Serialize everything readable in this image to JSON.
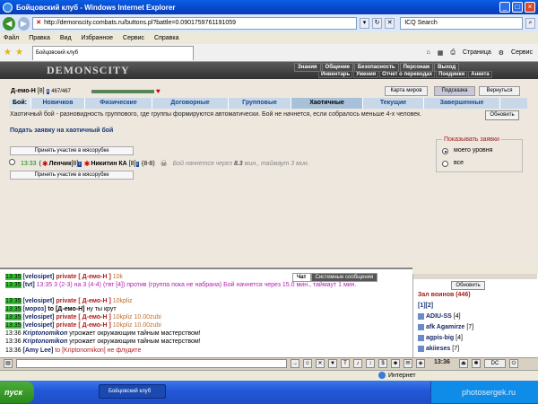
{
  "window": {
    "title": "Бойцовский клуб - Windows Internet Explorer"
  },
  "address": {
    "url": "http://demonscity.combats.ru/buttons.pl?battle=0.0901759761191059",
    "search_placeholder": "ICQ Search"
  },
  "menu": [
    "Файл",
    "Правка",
    "Вид",
    "Избранное",
    "Сервис",
    "Справка"
  ],
  "browser_tab": {
    "label": "Бойцовский клуб"
  },
  "browser_tools": {
    "page": "Страница",
    "tools": "Сервис"
  },
  "game": {
    "logo": "DEMONSCITY",
    "nav_top": [
      "Знания",
      "Общение",
      "Безопасность",
      "Персонаж",
      "Выход"
    ],
    "nav_bottom": [
      "Инвентарь",
      "Умения",
      "Отчет о переводах",
      "Поединки",
      "Анкета"
    ]
  },
  "player": {
    "name": "Д-емо-Н",
    "level": "[8]",
    "hp": "467/467"
  },
  "top_buttons": {
    "map": "Карта миров",
    "hint": "Подсказка",
    "back": "Вернуться"
  },
  "tabs": {
    "prefix": "Бой:",
    "items": [
      "Новичков",
      "Физические",
      "Договорные",
      "Групповые",
      "Хаотичные",
      "Текущие",
      "Завершенные"
    ]
  },
  "description": "Хаотичный бой - разновидность группового, где группы формируются автоматически. Бой не начнется, если собралось меньше 4-х человек.",
  "submit_link": "Подать заявку на хаотичный бой",
  "refresh_label": "Обновить",
  "join_label": "Принять участие в мясорубке",
  "bid": {
    "time": "13:33",
    "player1": "Ленчик",
    "player1_level": "[8]",
    "player2": "Никитин КА",
    "player2_level": "[8]",
    "levels": "(8-8)",
    "status_prefix": "Бой начнется через",
    "status_value": "8.3",
    "status_suffix": "мин., таймаут 3 мин."
  },
  "filter": {
    "title": "Показывать заявки",
    "option1": "моего уровня",
    "option2": "все"
  },
  "chat_tabs": {
    "chat": "Чат",
    "system": "Системные сообщения"
  },
  "chat_lines": [
    {
      "time": "13:35",
      "nick": "[velosipet]",
      "priv": "private [ Д-емо-Н ]",
      "msg": "10k"
    },
    {
      "time": "13:35",
      "nick": "[tvt]",
      "pur": "13:35 3 (2-3) на 3 (4-4) (твт [4]) против (группа пока не набрана) Бой начнется через 15.0 мин., таймаут 1 мин."
    },
    {
      "time": "13:35",
      "nick": "[velosipet]",
      "priv": "private [ Д-емо-Н ]",
      "msg": "10kpliz"
    },
    {
      "time": "13:35",
      "nick": "[мороз]",
      "to": "to [Д-емо-Н]",
      "plain": "ну ты крут"
    },
    {
      "time": "13:35",
      "nick": "[velosipet]",
      "priv": "private [ Д-емо-Н ]",
      "msg": "10kpliz 10.00zubi"
    },
    {
      "time": "13:35",
      "nick": "[velosipet]",
      "priv": "private [ Д-емо-Н ]",
      "msg": "10kpliz 10.00zubi"
    },
    {
      "time": "13:36",
      "krip": "Kriptonomikon",
      "plain": "угрожает окружающим тайным мастерством!"
    },
    {
      "time": "13:36",
      "krip": "Kriptonomikon",
      "plain": "угрожает окружающим тайным мастерством!"
    },
    {
      "time": "13:36",
      "nick": "[Amy Lee]",
      "to": "to [Kriptonomikon]",
      "plain": "не флудите"
    }
  ],
  "sidebar": {
    "refresh": "Обновить",
    "title": "Зал воинов (446)",
    "pages": "[1][2]",
    "players": [
      {
        "name": "ADIU-SS",
        "level": "[4]"
      },
      {
        "name": "afk Agamirze",
        "level": "[7]"
      },
      {
        "name": "agpis-big",
        "level": "[4]"
      },
      {
        "name": "akiieses",
        "level": "[7]"
      }
    ]
  },
  "clock": "13:36",
  "ie_status": {
    "zone": "Интернет"
  },
  "taskbar": {
    "start": "пуск",
    "item": "Бойцовский клуб",
    "watermark": "photosergek.ru"
  },
  "colors": {
    "accent": "#1a4a8a",
    "tab_bg": "#c8d8e8",
    "hp": "#2aa02a",
    "time_hl": "#3ac23a"
  }
}
